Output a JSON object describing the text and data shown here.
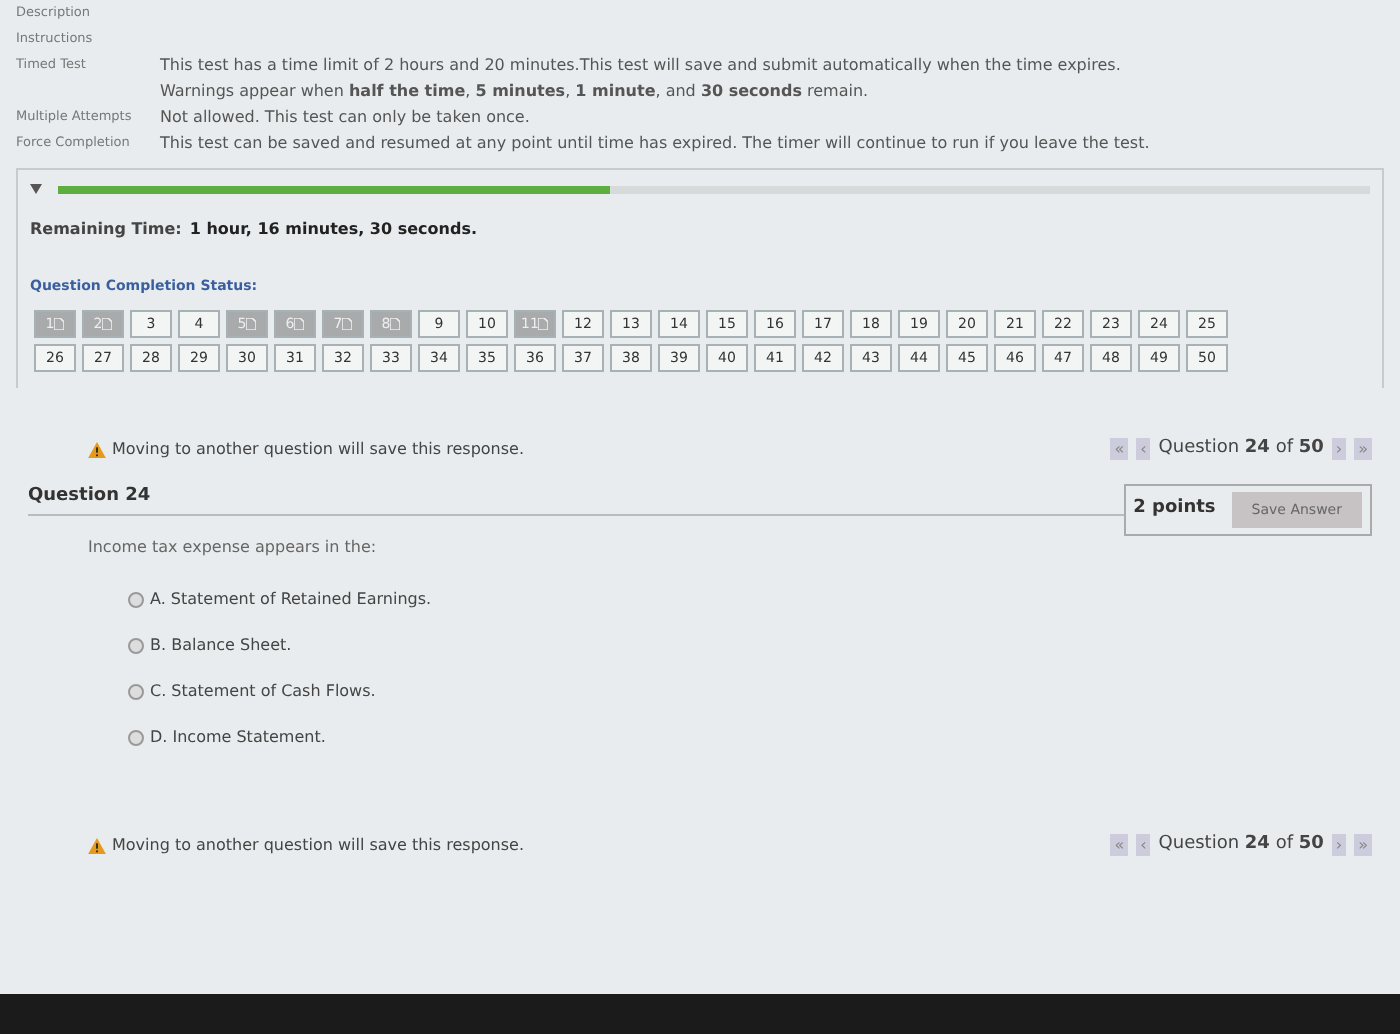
{
  "details": [
    {
      "label": "Description"
    },
    {
      "label": "Instructions"
    },
    {
      "label": "Timed Test",
      "text": "This test has a time limit of 2 hours and 20 minutes.This test will save and submit automatically when the time expires.",
      "text2": "Warnings appear when **half the time**, **5 minutes**, **1 minute**, and **30 seconds** remain."
    },
    {
      "label": "Multiple Attempts",
      "text": "Not allowed. This test can only be taken once."
    },
    {
      "label": "Force Completion",
      "text": "This test can be saved and resumed at any point until time has expired. The timer will continue to run if you leave the test."
    }
  ],
  "timer": {
    "level": 0.42,
    "label": "Remaining Time:",
    "value": "1 hour, 16 minutes, 30 seconds."
  },
  "completion": {
    "title": "Question Completion Status:",
    "questions": [
      {
        "label": "1",
        "answered": true
      },
      {
        "label": "2",
        "answered": true
      },
      {
        "label": "3",
        "answered": false
      },
      {
        "label": "4",
        "answered": false
      },
      {
        "label": "5",
        "answered": true
      },
      {
        "label": "6",
        "answered": true
      },
      {
        "label": "7",
        "answered": true
      },
      {
        "label": "8",
        "answered": true
      },
      {
        "label": "9",
        "answered": false
      },
      {
        "label": "10",
        "answered": false
      },
      {
        "label": "11",
        "answered": true
      },
      {
        "label": "12",
        "answered": false
      },
      {
        "label": "13",
        "answered": false
      },
      {
        "label": "14",
        "answered": false
      },
      {
        "label": "15",
        "answered": false
      },
      {
        "label": "16",
        "answered": false
      },
      {
        "label": "17",
        "answered": false
      },
      {
        "label": "18",
        "answered": false
      },
      {
        "label": "19",
        "answered": false
      },
      {
        "label": "20",
        "answered": false
      },
      {
        "label": "21",
        "answered": false
      },
      {
        "label": "22",
        "answered": false
      },
      {
        "label": "23",
        "answered": false
      },
      {
        "label": "24",
        "answered": false
      },
      {
        "label": "25",
        "answered": false
      },
      {
        "label": "26",
        "answered": false
      },
      {
        "label": "27",
        "answered": false
      },
      {
        "label": "28",
        "answered": false
      },
      {
        "label": "29",
        "answered": false
      },
      {
        "label": "30",
        "answered": false
      },
      {
        "label": "31",
        "answered": false
      },
      {
        "label": "32",
        "answered": false
      },
      {
        "label": "33",
        "answered": false
      },
      {
        "label": "34",
        "answered": false
      },
      {
        "label": "35",
        "answered": false
      },
      {
        "label": "36",
        "answered": false
      },
      {
        "label": "37",
        "answered": false
      },
      {
        "label": "38",
        "answered": false
      },
      {
        "label": "39",
        "answered": false
      },
      {
        "label": "40",
        "answered": false
      },
      {
        "label": "41",
        "answered": false
      },
      {
        "label": "42",
        "answered": false
      },
      {
        "label": "43",
        "answered": false
      },
      {
        "label": "44",
        "answered": false
      },
      {
        "label": "45",
        "answered": false
      },
      {
        "label": "46",
        "answered": false
      },
      {
        "label": "47",
        "answered": false
      },
      {
        "label": "48",
        "answered": false
      },
      {
        "label": "49",
        "answered": false
      },
      {
        "label": "50",
        "answered": false
      }
    ]
  },
  "top_nav": {
    "warning": "Moving to another question will save this response.",
    "first": "«",
    "prev": "‹",
    "position": "Question **24** of **50**",
    "next": "›",
    "last": "»"
  },
  "question": {
    "title": "Question 24",
    "points": "2 points",
    "save": "Save Answer",
    "prompt": "Income tax expense appears in the:",
    "options": [
      {
        "label": "A. Statement of Retained Earnings.",
        "selected": false
      },
      {
        "label": "B. Balance Sheet.",
        "selected": false
      },
      {
        "label": "C. Statement of Cash Flows.",
        "selected": false
      },
      {
        "label": "D. Income Statement.",
        "selected": false
      }
    ]
  },
  "bottom_nav": {
    "warning": "Moving to another question will save this response.",
    "first": "«",
    "prev": "‹",
    "position": "Question **24** of **50**",
    "next": "›",
    "last": "»"
  }
}
